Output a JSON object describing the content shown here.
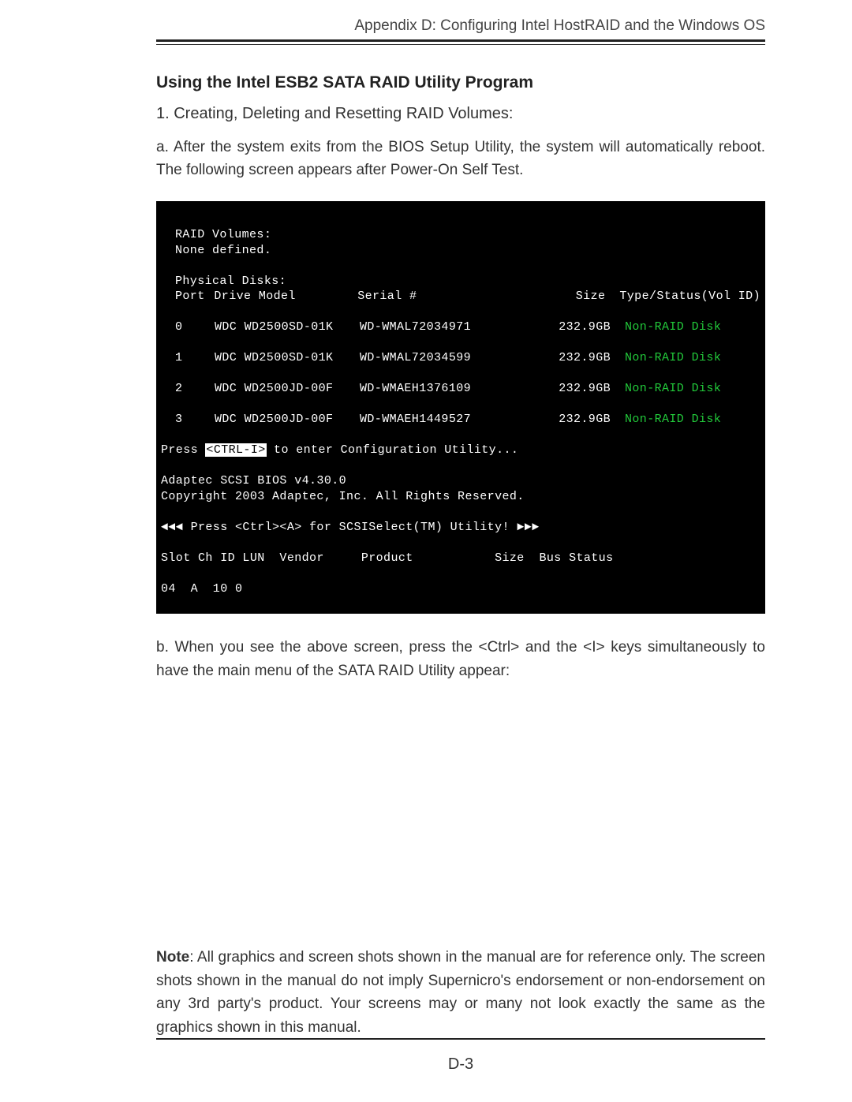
{
  "header": {
    "text": "Appendix D: Configuring Intel HostRAID and the Windows OS"
  },
  "section": {
    "heading": "Using the Intel ESB2 SATA RAID Utility Program",
    "step1": "1. Creating, Deleting and Resetting RAID Volumes:",
    "step_a": "a. After the system exits from the BIOS Setup Utility, the system will automatically reboot. The following screen appears after Power-On Self Test.",
    "step_b": "b. When you see the above screen, press the <Ctrl> and the <I> keys simultaneously to have the main menu of the SATA RAID Utility appear:"
  },
  "terminal": {
    "raid_volumes_label": "RAID Volumes:",
    "raid_volumes_value": "None defined.",
    "physical_disks_label": "Physical Disks:",
    "columns": {
      "port": "Port",
      "model": "Drive Model",
      "serial": "Serial #",
      "size": "Size",
      "type": "Type/Status(Vol ID)"
    },
    "disks": [
      {
        "port": "0",
        "model": "WDC WD2500SD-01K",
        "serial": "WD-WMAL72034971",
        "size": "232.9GB",
        "type": "Non-RAID Disk"
      },
      {
        "port": "1",
        "model": "WDC WD2500SD-01K",
        "serial": "WD-WMAL72034599",
        "size": "232.9GB",
        "type": "Non-RAID Disk"
      },
      {
        "port": "2",
        "model": "WDC WD2500JD-00F",
        "serial": "WD-WMAEH1376109",
        "size": "232.9GB",
        "type": "Non-RAID Disk"
      },
      {
        "port": "3",
        "model": "WDC WD2500JD-00F",
        "serial": "WD-WMAEH1449527",
        "size": "232.9GB",
        "type": "Non-RAID Disk"
      }
    ],
    "press_prefix": "Press ",
    "ctrl_i": "<CTRL-I>",
    "press_suffix": " to enter Configuration Utility...",
    "adaptec_line1": "Adaptec SCSI BIOS v4.30.0",
    "adaptec_line2": "Copyright 2003 Adaptec, Inc. All Rights Reserved.",
    "scsiselect": "◄◄◄ Press <Ctrl><A> for SCSISelect(TM) Utility! ►►►",
    "scsi_header": "Slot Ch ID LUN  Vendor     Product           Size  Bus Status",
    "scsi_row": "04  A  10 0"
  },
  "note": {
    "label": "Note",
    "text": ": All graphics and screen shots shown in the manual are for reference only.  The screen shots shown in the manual do not imply Supernicro's endorsement or non-endorsement on any 3rd party's product. Your screens may or many not look exactly the same as the graphics shown in this manual."
  },
  "page_number": "D-3"
}
